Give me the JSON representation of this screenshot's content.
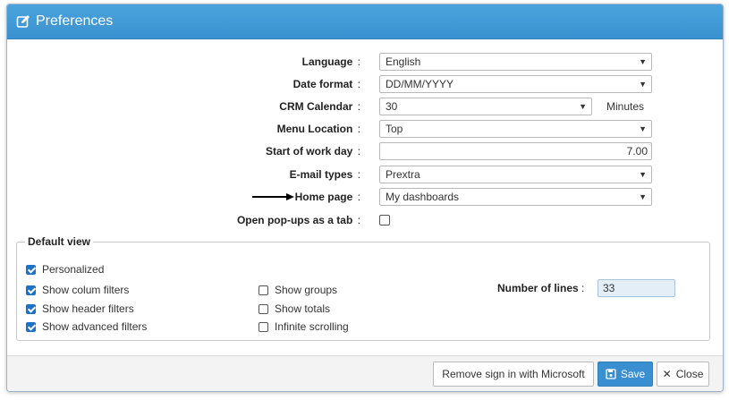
{
  "dialog": {
    "title": "Preferences",
    "icon": "edit-icon"
  },
  "form": {
    "language": {
      "label": "Language",
      "value": "English"
    },
    "date_format": {
      "label": "Date format",
      "value": "DD/MM/YYYY"
    },
    "crm_calendar": {
      "label": "CRM Calendar",
      "value": "30",
      "unit": "Minutes"
    },
    "menu_location": {
      "label": "Menu Location",
      "value": "Top"
    },
    "start_of_work_day": {
      "label": "Start of work day",
      "value": "7.00"
    },
    "email_types": {
      "label": "E-mail types",
      "value": "Prextra"
    },
    "home_page": {
      "label": "Home page",
      "value": "My dashboards"
    },
    "open_popups": {
      "label": "Open pop-ups as a tab",
      "checked": false
    },
    "colon": ":"
  },
  "default_view": {
    "legend": "Default view",
    "personalized": {
      "label": "Personalized",
      "checked": true
    },
    "show_column_filters": {
      "label": "Show colum filters",
      "checked": true
    },
    "show_header_filters": {
      "label": "Show header filters",
      "checked": true
    },
    "show_advanced_filters": {
      "label": "Show advanced filters",
      "checked": true
    },
    "show_groups": {
      "label": "Show groups",
      "checked": false
    },
    "show_totals": {
      "label": "Show totals",
      "checked": false
    },
    "infinite_scrolling": {
      "label": "Infinite scrolling",
      "checked": false
    },
    "number_of_lines": {
      "label": "Number of lines",
      "value": "33"
    }
  },
  "footer": {
    "remove_sign_in": "Remove sign in with Microsoft",
    "save": "Save",
    "close": "Close"
  },
  "colors": {
    "header": "#3a91cf",
    "primary": "#3a8fd0",
    "checkbox": "#1a73c8"
  }
}
